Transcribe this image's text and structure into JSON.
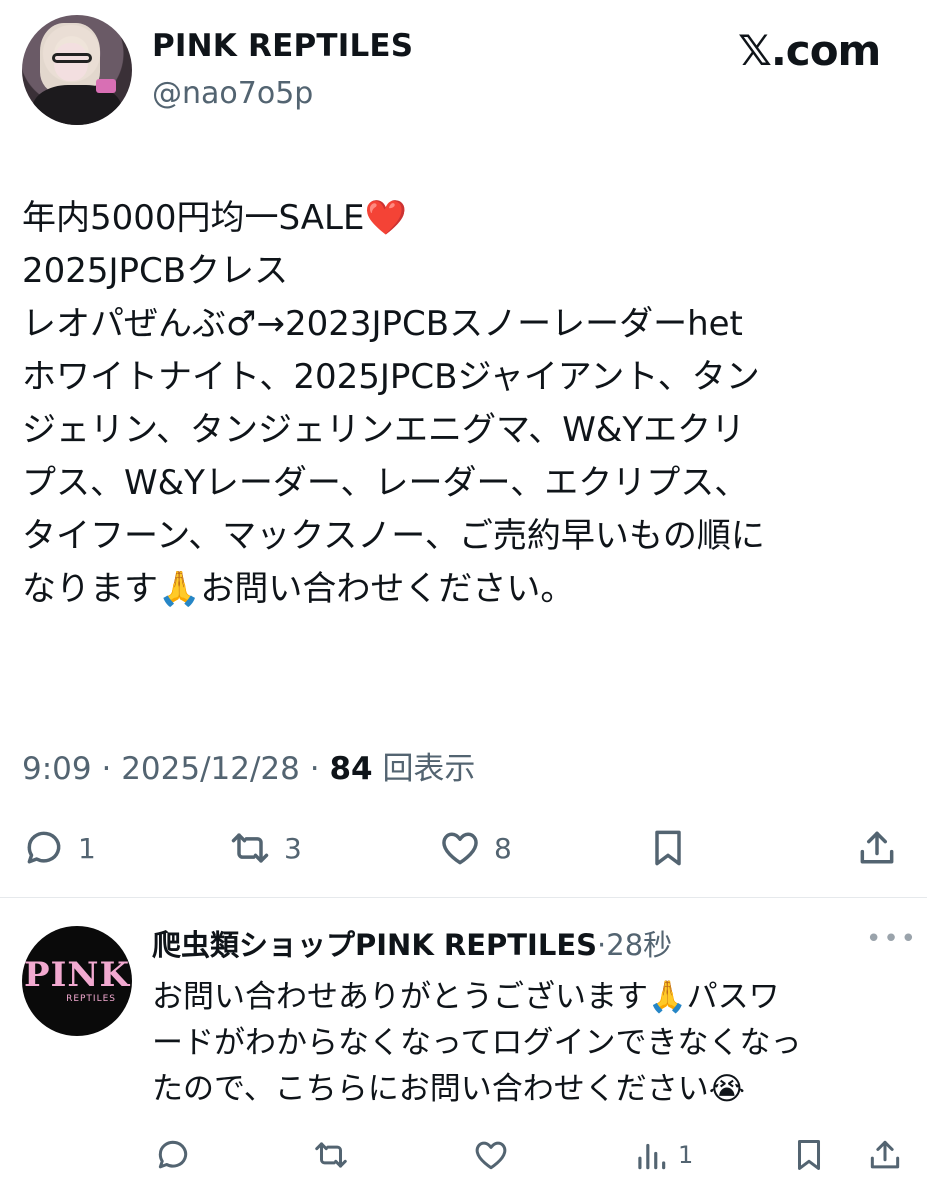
{
  "header": {
    "display_name": "PINK REPTILES",
    "handle": "@nao7o5p",
    "site": "𝕏.com"
  },
  "tweet": {
    "text_line1": "年内5000円均一SALE",
    "text_rest": "2025JPCBクレス\nレオパぜんぶ♂→2023JPCBスノーレーダーhet\nホワイトナイト、2025JPCBジャイアント、タン\nジェリン、タンジェリンエニグマ、W&Yエクリ\nプス、W&Yレーダー、レーダー、エクリプス、\nタイフーン、マックスノー、ご売約早いもの順に\nなります🙏お問い合わせください。",
    "heart_emoji": "❤️",
    "time": "9:09",
    "date": "2025/12/28",
    "views_count": "84",
    "views_label": "回表示"
  },
  "actions": {
    "reply_count": "1",
    "retweet_count": "3",
    "like_count": "8"
  },
  "reply": {
    "name": "爬虫類ショップPINK REPTILES",
    "time": "28秒",
    "text": "お問い合わせありがとうございます🙏パスワ\nードがわからなくなってログインできなくなっ\nたので、こちらにお問い合わせください😭",
    "avatar_logo": "PINK",
    "avatar_logo_sub": "REPTILES",
    "views_count": "1"
  }
}
